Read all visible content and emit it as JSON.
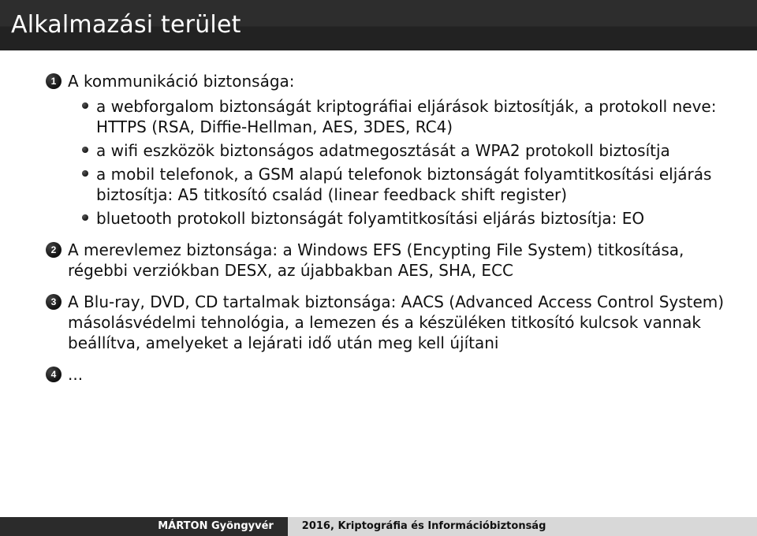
{
  "slide": {
    "title": "Alkalmazási terület",
    "items": [
      {
        "num": "1",
        "text": "A kommunikáció biztonsága:",
        "sub": [
          "a webforgalom biztonságát kriptográfiai eljárások biztosítják, a protokoll neve: HTTPS (RSA, Diffie-Hellman, AES, 3DES, RC4)",
          "a wifi eszközök biztonságos adatmegosztását a WPA2 protokoll biztosítja",
          "a mobil telefonok, a GSM alapú telefonok biztonságát folyamtitkosítási eljárás biztosítja: A5 titkosító család (linear feedback shift register)",
          "bluetooth protokoll biztonságát folyamtitkosítási eljárás biztosítja: EO"
        ]
      },
      {
        "num": "2",
        "text": "A merevlemez biztonsága: a Windows EFS (Encypting File System) titkosítása, régebbi verziókban DESX, az újabbakban AES, SHA, ECC",
        "sub": []
      },
      {
        "num": "3",
        "text": "A Blu-ray, DVD, CD tartalmak biztonsága: AACS (Advanced Access Control System) másolásvédelmi tehnológia, a lemezen és a készüléken titkosító kulcsok vannak beállítva, amelyeket a lejárati idő után meg kell újítani",
        "sub": []
      },
      {
        "num": "4",
        "text": "...",
        "sub": []
      }
    ]
  },
  "footer": {
    "author": "MÁRTON Gyöngyvér",
    "course": "2016, Kriptográfia és Információbiztonság"
  }
}
